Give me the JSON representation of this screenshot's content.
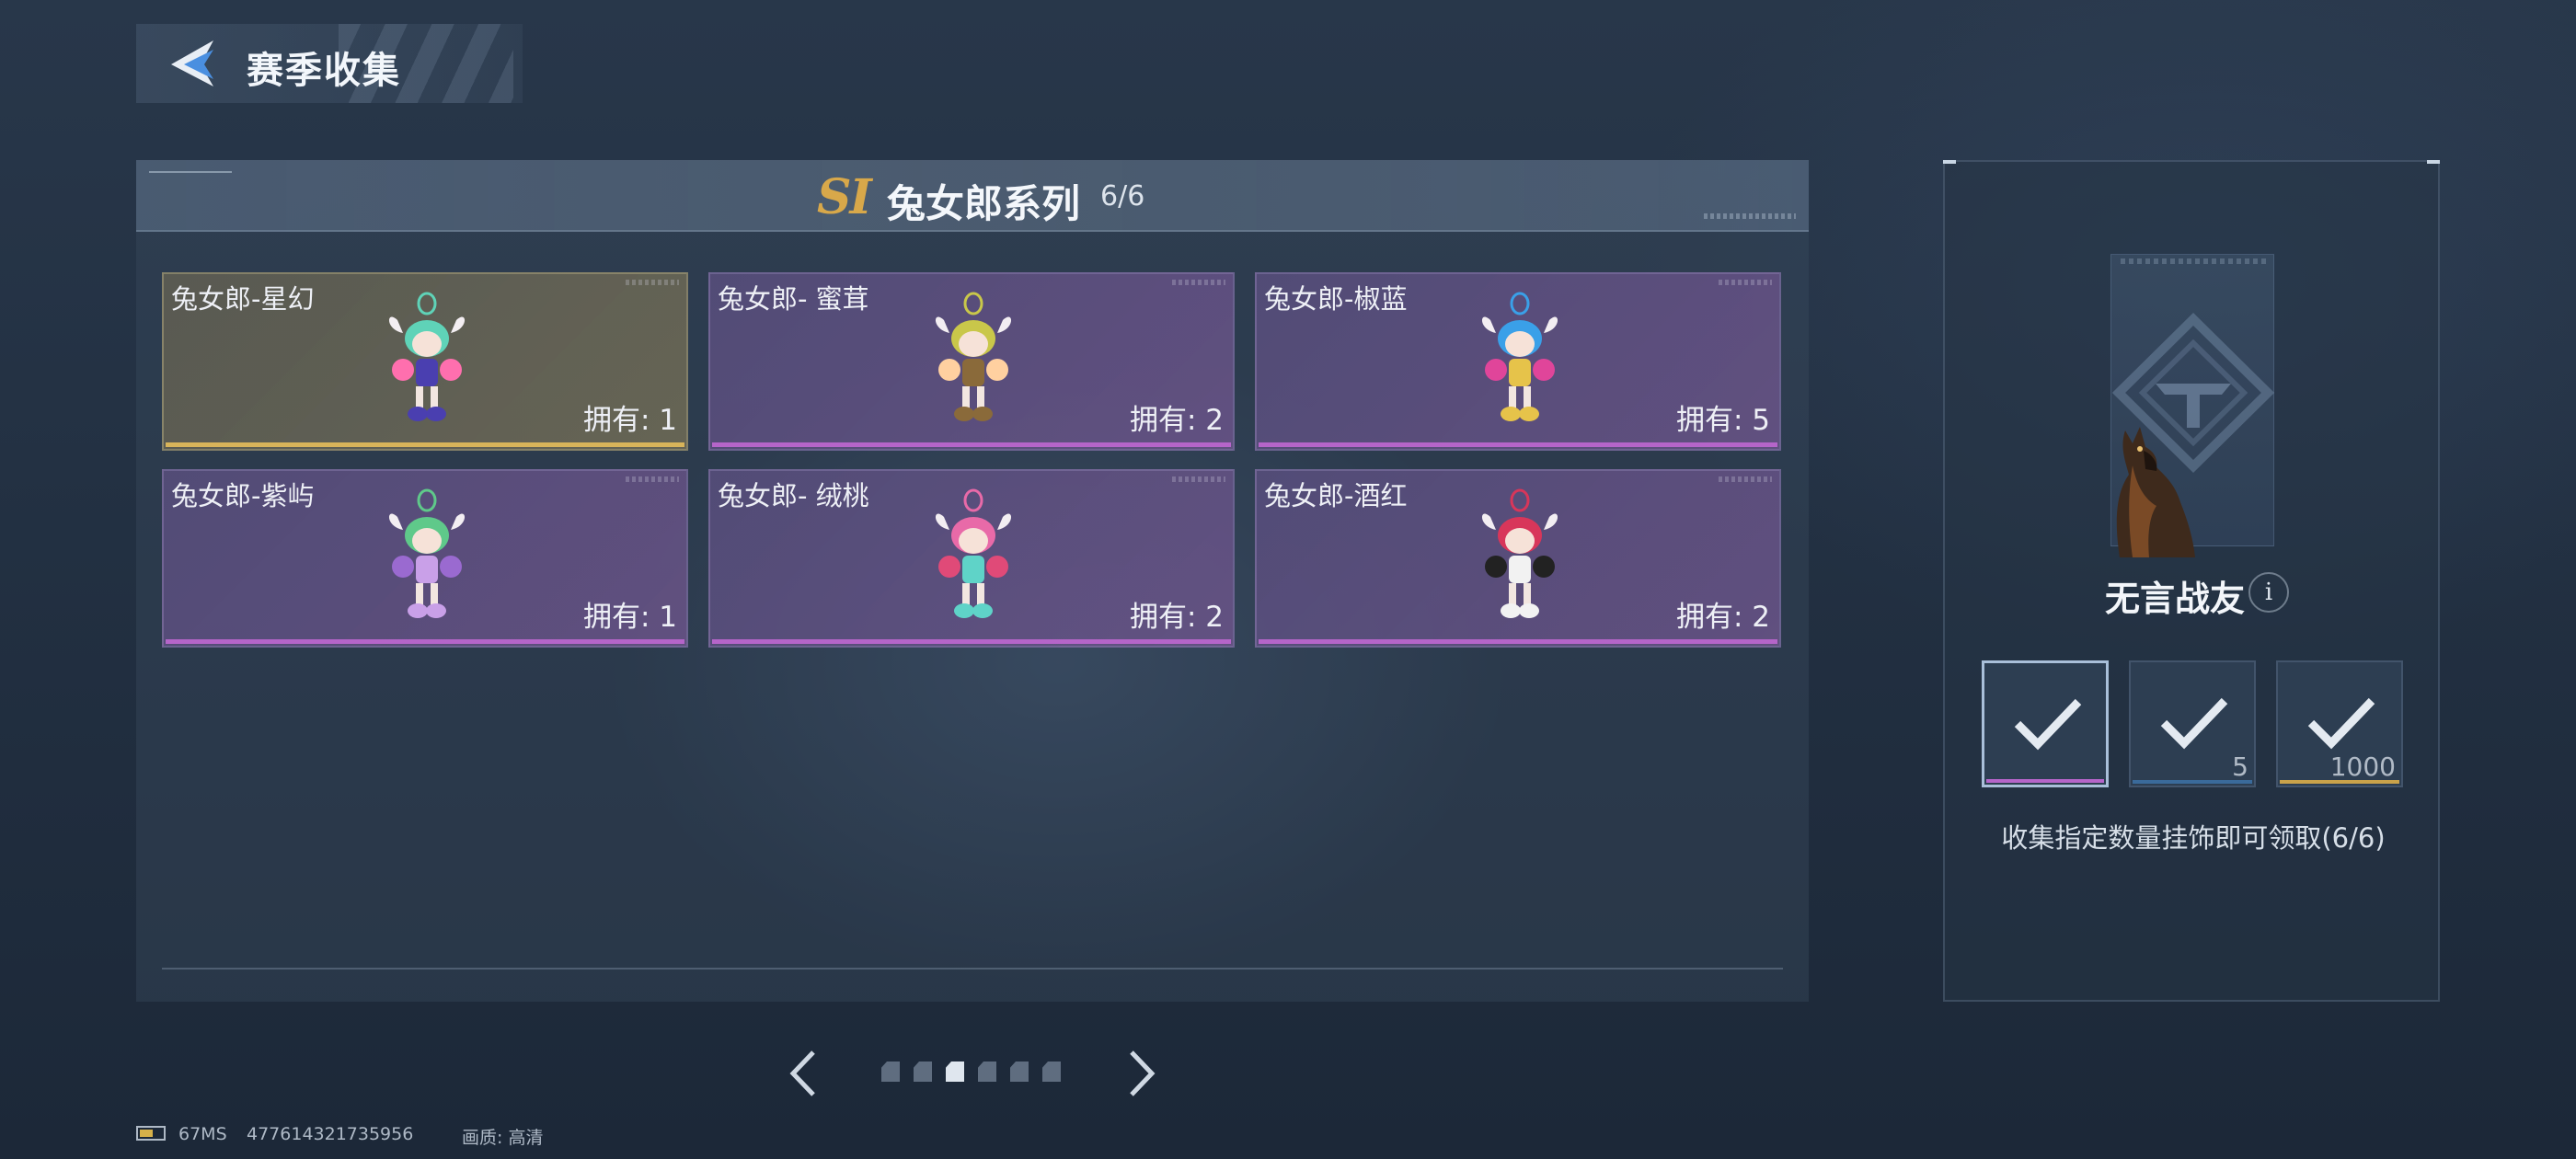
{
  "header": {
    "title": "赛季收集"
  },
  "series": {
    "badge": "SI",
    "title": "兔女郎系列",
    "count": "6/6"
  },
  "cards": [
    {
      "name": "兔女郎-星幻",
      "owned": "拥有: 1",
      "rarity": "gold",
      "colors": [
        "#5fd3b8",
        "#4a3fb0",
        "#ff6fae"
      ]
    },
    {
      "name": "兔女郎- 蜜茸",
      "owned": "拥有: 2",
      "rarity": "purple",
      "colors": [
        "#c9c74a",
        "#8a6a3a",
        "#ffd0a0"
      ]
    },
    {
      "name": "兔女郎-椒蓝",
      "owned": "拥有: 5",
      "rarity": "purple",
      "colors": [
        "#3aa0e8",
        "#e6c34a",
        "#e0459a"
      ]
    },
    {
      "name": "兔女郎-紫屿",
      "owned": "拥有: 1",
      "rarity": "purple",
      "colors": [
        "#5fc98a",
        "#c9a0e8",
        "#9a6ad0"
      ]
    },
    {
      "name": "兔女郎- 绒桃",
      "owned": "拥有: 2",
      "rarity": "purple",
      "colors": [
        "#e86aa8",
        "#5fd3c8",
        "#e04a78"
      ]
    },
    {
      "name": "兔女郎-酒红",
      "owned": "拥有: 2",
      "rarity": "purple",
      "colors": [
        "#d8365a",
        "#f2f2f2",
        "#222222"
      ]
    }
  ],
  "pager": {
    "total": 6,
    "active": 2,
    "prev_icon": "chevron-left-icon",
    "next_icon": "chevron-right-icon"
  },
  "reward": {
    "title": "无言战友",
    "info_label": "i",
    "slots": [
      {
        "qty": "",
        "icon": "dog-card-icon",
        "bar_color": "#b565c9"
      },
      {
        "qty": "5",
        "icon": "armor-icon",
        "bar_color": "#3a6a9a"
      },
      {
        "qty": "1000",
        "icon": "currency-icon",
        "bar_color": "#c9a24a"
      }
    ],
    "description": "收集指定数量挂饰即可领取(6/6)"
  },
  "status": {
    "ping": "67MS",
    "uid": "477614321735956",
    "quality": "画质: 高清"
  },
  "colors": {
    "gold": "#d8b45a",
    "purple": "#b565c9",
    "accent": "#d8a84a"
  }
}
